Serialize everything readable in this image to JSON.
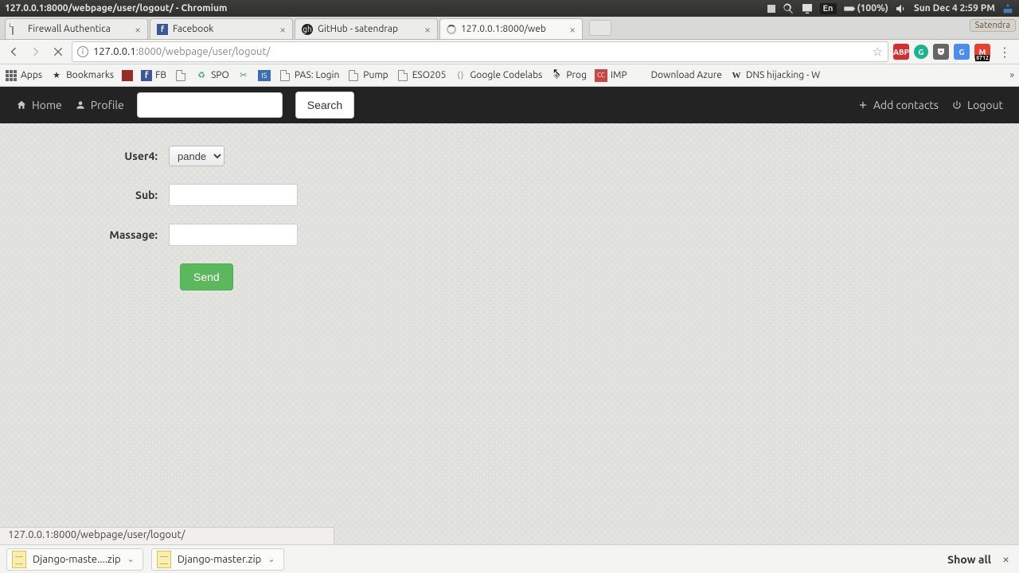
{
  "titlebar": {
    "title": "127.0.0.1:8000/webpage/user/logout/ - Chromium"
  },
  "tray": {
    "lang": "En",
    "battery": "(100%)",
    "clock": "Sun Dec  4  2:59 PM"
  },
  "user_tag": "Satendra",
  "tabs": [
    {
      "label": "Firewall Authentica"
    },
    {
      "label": "Facebook"
    },
    {
      "label": "GitHub - satendrap"
    },
    {
      "label": "127.0.0.1:8000/web"
    }
  ],
  "address": {
    "host": "127.0.0.1",
    "port": ":8000",
    "path": "/webpage/user/logout/"
  },
  "gmail_count": "8712",
  "bookmarks": {
    "apps": "Apps",
    "items": [
      "Bookmarks",
      "",
      "FB",
      "",
      "SPO",
      "",
      "",
      "PAS: Login",
      "Pump",
      "ESO205",
      "Google Codelabs",
      "Prog",
      "IMP",
      "Download Azure",
      "DNS hijacking - W"
    ]
  },
  "nav": {
    "home": "Home",
    "profile": "Profile",
    "search_btn": "Search",
    "add_contacts": "Add contacts",
    "logout": "Logout"
  },
  "form": {
    "user_label": "User4:",
    "user_value": "pandey",
    "sub_label": "Sub:",
    "sub_value": "",
    "msg_label": "Massage:",
    "msg_value": "",
    "send": "Send"
  },
  "status_text": "127.0.0.1:8000/webpage/user/logout/",
  "downloads": {
    "items": [
      "Django-maste....zip",
      "Django-master.zip"
    ],
    "showall": "Show all"
  }
}
